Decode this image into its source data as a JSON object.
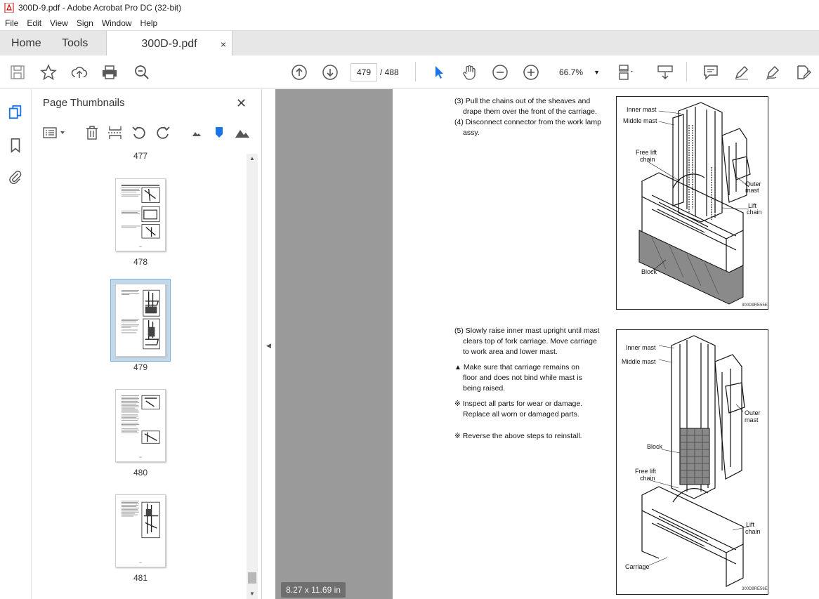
{
  "window": {
    "title": "300D-9.pdf - Adobe Acrobat Pro DC (32-bit)"
  },
  "menu": [
    "File",
    "Edit",
    "View",
    "Sign",
    "Window",
    "Help"
  ],
  "tabs": {
    "home": "Home",
    "tools": "Tools",
    "document": "300D-9.pdf",
    "close": "×"
  },
  "toolbar": {
    "current_page": "479",
    "page_total": "/ 488",
    "zoom": "66.7%"
  },
  "thumbnails": {
    "title": "Page Thumbnails",
    "close": "✕",
    "partial_label": "477",
    "pages": [
      {
        "label": "478"
      },
      {
        "label": "479",
        "selected": true
      },
      {
        "label": "480"
      },
      {
        "label": "481"
      }
    ]
  },
  "page_size": "8.27 x 11.69 in",
  "document": {
    "step3": "(3) Pull the chains out of the sheaves and drape them over the front of the carriage.",
    "step3a": "(3) Pull the chains out of the sheaves and",
    "step3b": "drape them over the front of the carriage.",
    "step4a": "(4) Disconnect connector from the work lamp",
    "step4b": "assy.",
    "step5a": "(5) Slowly raise inner mast upright until mast",
    "step5b": "clears top of fork carriage.  Move carriage",
    "step5c": "to work area and lower mast.",
    "warn_a": "Make sure that carriage remains on",
    "warn_b": "floor and does not bind while mast is",
    "warn_c": "being raised.",
    "note1a": "Inspect all parts for wear or damage.",
    "note1b": "Replace all worn or damaged parts.",
    "note2": "Reverse the above steps to reinstall.",
    "fig1": {
      "labels": [
        "Inner mast",
        "Middle mast",
        "Free lift",
        "chain",
        "Outer",
        "mast",
        "Lift",
        "chain",
        "Block"
      ],
      "code": "300D9RE55E"
    },
    "fig2": {
      "labels": [
        "Inner mast",
        "Middle mast",
        "Outer",
        "mast",
        "Block",
        "Free lift",
        "chain",
        "Lift",
        "chain",
        "Carriage"
      ],
      "code": "300D9RE56E"
    }
  }
}
